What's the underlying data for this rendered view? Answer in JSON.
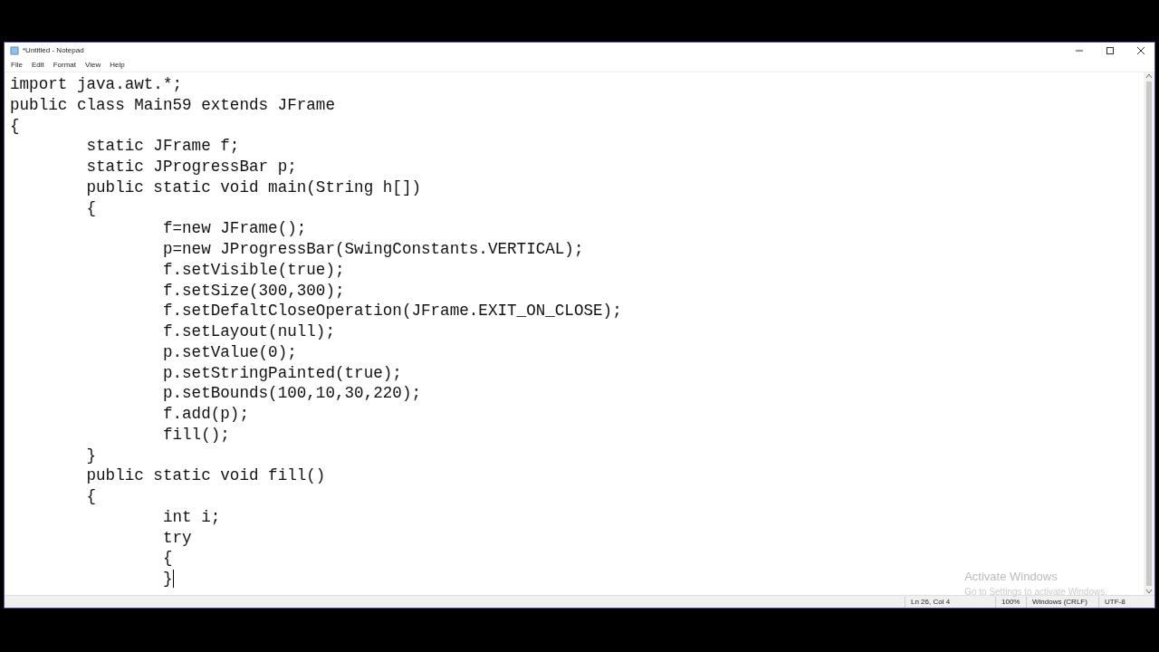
{
  "window": {
    "title": "*Untitled - Notepad"
  },
  "menu": [
    "File",
    "Edit",
    "Format",
    "View",
    "Help"
  ],
  "editor": {
    "lines": [
      "import java.awt.*;",
      "public class Main59 extends JFrame",
      "{",
      "\tstatic JFrame f;",
      "\tstatic JProgressBar p;",
      "\tpublic static void main(String h[])",
      "\t{",
      "\t\tf=new JFrame();",
      "\t\tp=new JProgressBar(SwingConstants.VERTICAL);",
      "\t\tf.setVisible(true);",
      "\t\tf.setSize(300,300);",
      "\t\tf.setDefaltCloseOperation(JFrame.EXIT_ON_CLOSE);",
      "\t\tf.setLayout(null);",
      "\t\tp.setValue(0);",
      "\t\tp.setStringPainted(true);",
      "\t\tp.setBounds(100,10,30,220);",
      "\t\tf.add(p);",
      "\t\tfill();",
      "\t}",
      "\tpublic static void fill()",
      "\t{",
      "\t\tint i;",
      "\t\ttry",
      "\t\t{",
      "\t\t}"
    ]
  },
  "activation_notice": {
    "title": "Activate Windows",
    "subtitle": "Go to Settings to activate Windows."
  },
  "status_bar": [
    "Ln 26, Col 4",
    "100%",
    "Windows (CRLF)",
    "UTF-8"
  ]
}
